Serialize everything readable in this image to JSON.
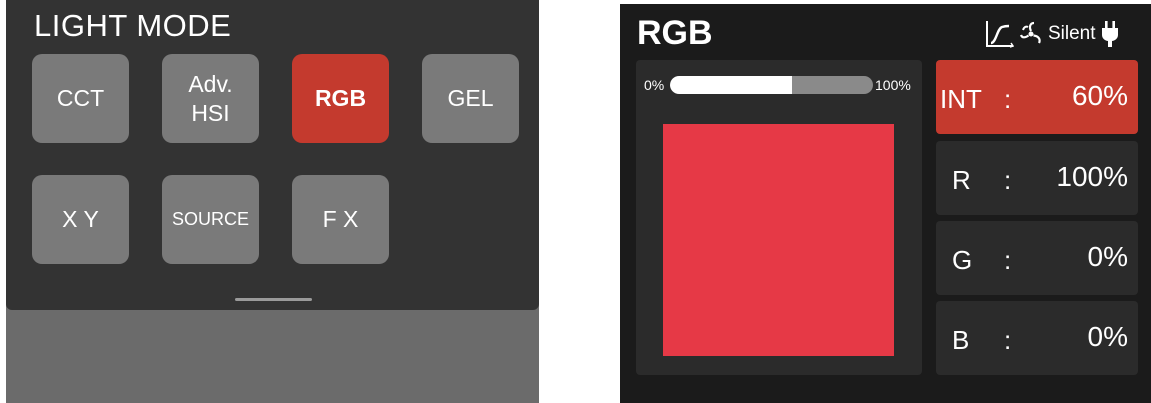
{
  "light_mode": {
    "title": "LIGHT MODE",
    "buttons": [
      {
        "label": "CCT"
      },
      {
        "label": "Adv.\nHSI"
      },
      {
        "label": "RGB",
        "active": true
      },
      {
        "label": "GEL"
      },
      {
        "label": "X Y"
      },
      {
        "label": "SOURCE"
      },
      {
        "label": "F X"
      }
    ]
  },
  "rgb_screen": {
    "title": "RGB",
    "status": {
      "icons": [
        "curve-icon",
        "fan-icon",
        "power-plug-icon"
      ],
      "silent_label": "Silent"
    },
    "intensity_bar": {
      "min_label": "0%",
      "max_label": "100%",
      "fraction": 0.6
    },
    "swatch_color": "#e63946",
    "params": [
      {
        "label": "INT",
        "colon": ":",
        "value": "60%",
        "active": true
      },
      {
        "label": "R",
        "colon": ":",
        "value": "100%"
      },
      {
        "label": "G",
        "colon": ":",
        "value": "0%"
      },
      {
        "label": "B",
        "colon": ":",
        "value": "0%"
      }
    ],
    "colors": {
      "accent": "#c43a2e",
      "background": "#1b1b1b",
      "panel": "#2b2b2b"
    }
  }
}
